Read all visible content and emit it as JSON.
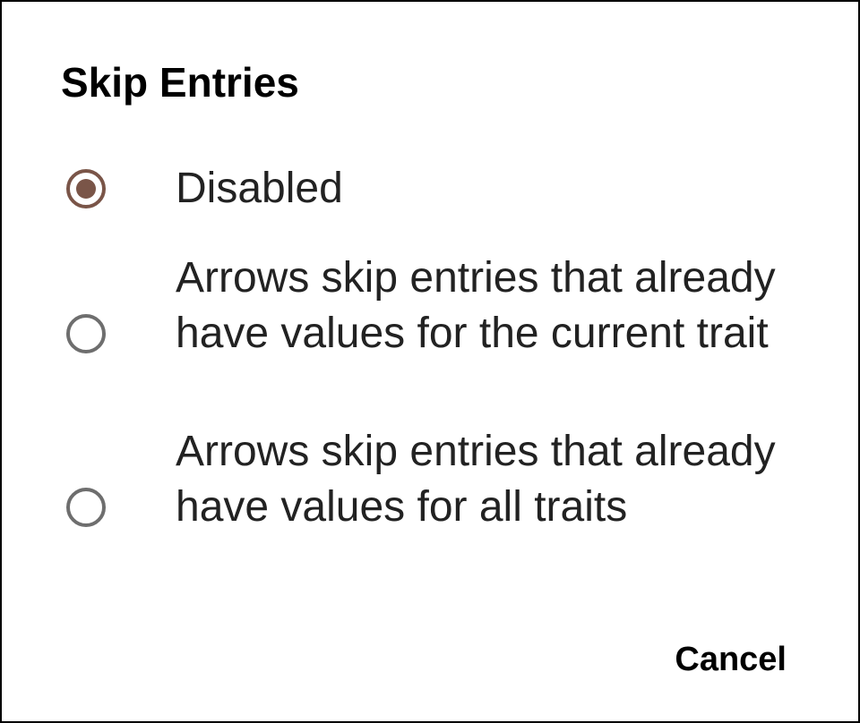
{
  "dialog": {
    "title": "Skip Entries",
    "options": [
      {
        "label": "Disabled",
        "selected": true
      },
      {
        "label": "Arrows skip entries that already have values for the current trait",
        "selected": false
      },
      {
        "label": "Arrows skip entries that already have values for all traits",
        "selected": false
      }
    ],
    "cancel_label": "Cancel",
    "accent_color": "#7a5548",
    "radio_unchecked_color": "#6e6e6e"
  }
}
